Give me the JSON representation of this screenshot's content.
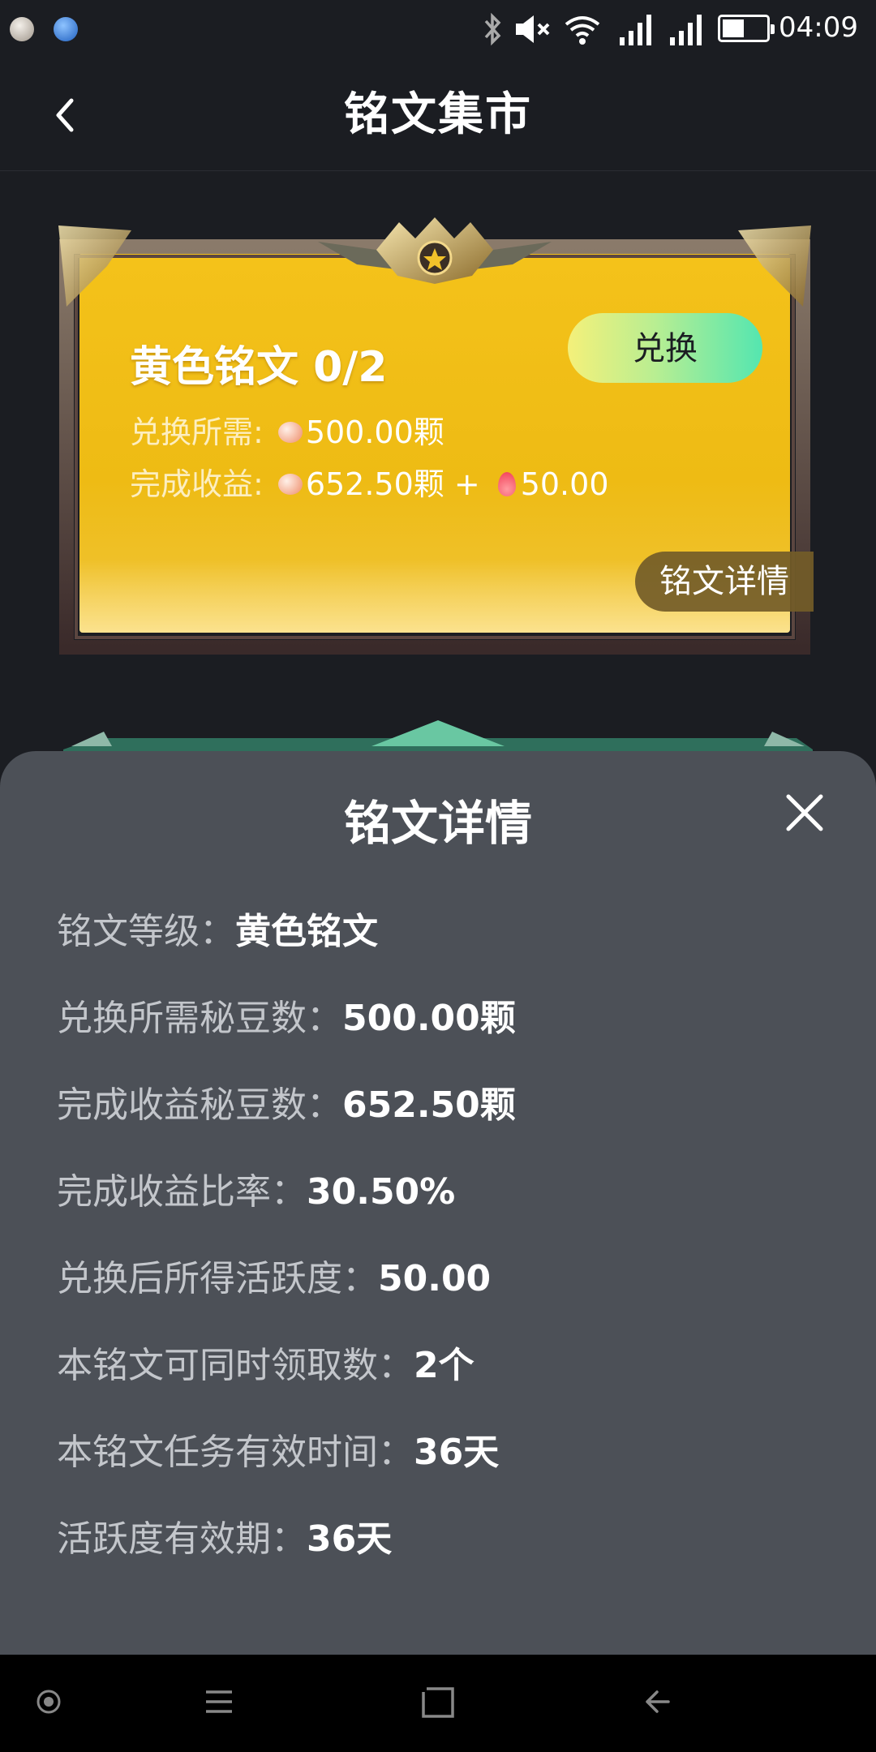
{
  "status_bar": {
    "time": "04:09",
    "icons": [
      "bluetooth-icon",
      "muted-icon",
      "wifi-icon",
      "signal-icon",
      "signal-icon",
      "battery-icon"
    ]
  },
  "header": {
    "title": "铭文集市",
    "back_icon": "chevron-left-icon"
  },
  "card": {
    "title": "黄色铭文 0/2",
    "exchange_label": "兑换",
    "cost_label": "兑换所需:",
    "cost_value": "500.00颗",
    "reward_label": "完成收益:",
    "reward_value": "652.50颗 +",
    "activity_value": "50.00",
    "detail_tag": "铭文详情",
    "accent": "#f1c21b"
  },
  "sheet": {
    "title": "铭文详情",
    "rows": [
      {
        "label": "铭文等级：",
        "value": "黄色铭文"
      },
      {
        "label": "兑换所需秘豆数：",
        "value": "500.00颗"
      },
      {
        "label": "完成收益秘豆数：",
        "value": "652.50颗"
      },
      {
        "label": "完成收益比率：",
        "value": "30.50%"
      },
      {
        "label": "兑换后所得活跃度：",
        "value": "50.00"
      },
      {
        "label": "本铭文可同时领取数：",
        "value": "2个"
      },
      {
        "label": "本铭文任务有效时间：",
        "value": "36天"
      },
      {
        "label": "活跃度有效期：",
        "value": "36天"
      }
    ]
  },
  "nav_bar": {
    "icons": [
      "circle-icon",
      "menu-icon",
      "square-icon",
      "back-arrow-icon"
    ]
  }
}
